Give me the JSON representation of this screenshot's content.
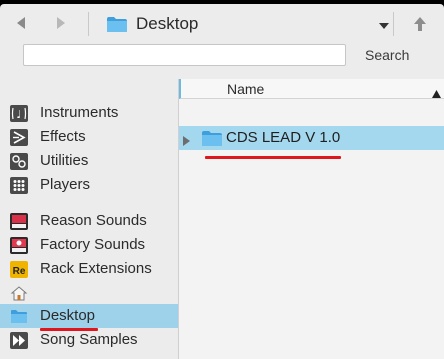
{
  "toolbar": {
    "path_label": "Desktop",
    "back_icon": "back-arrow-icon",
    "forward_icon": "forward-arrow-icon",
    "up_icon": "up-arrow-icon"
  },
  "search": {
    "value": "",
    "placeholder": "",
    "button_label": "Search"
  },
  "sidebar": {
    "items": [
      {
        "label": "Instruments",
        "icon": "instruments-icon"
      },
      {
        "label": "Effects",
        "icon": "effects-icon"
      },
      {
        "label": "Utilities",
        "icon": "utilities-icon"
      },
      {
        "label": "Players",
        "icon": "players-icon"
      },
      {
        "label": "Reason Sounds",
        "icon": "reason-sounds-icon"
      },
      {
        "label": "Factory Sounds",
        "icon": "factory-sounds-icon"
      },
      {
        "label": "Rack Extensions",
        "icon": "rack-extensions-icon"
      },
      {
        "label": "",
        "icon": "home-icon"
      },
      {
        "label": "Desktop",
        "icon": "desktop-folder-icon",
        "selected": true
      },
      {
        "label": "Song Samples",
        "icon": "song-samples-icon"
      }
    ]
  },
  "file_list": {
    "column_name": "Name",
    "sort_direction": "ascending",
    "rows": [
      {
        "name": "CDS LEAD V 1.0",
        "icon": "folder-icon",
        "selected": true
      }
    ]
  },
  "colors": {
    "selection": "#a4d8ee",
    "annotation": "#e0161e",
    "folder": "#4aa8e0"
  }
}
